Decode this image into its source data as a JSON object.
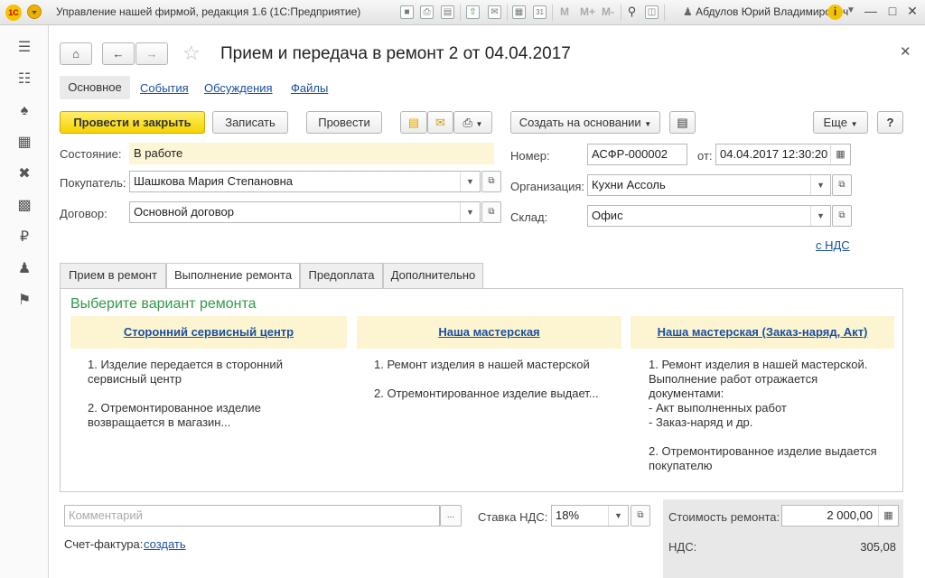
{
  "titlebar": {
    "logo": "1С",
    "title": "Управление нашей фирмой, редакция 1.6  (1С:Предприятие)",
    "user": "Абдулов Юрий Владимирович",
    "icons": [
      "save-icon",
      "print-icon",
      "preview-icon",
      "upload-icon",
      "mail-icon",
      "calculator-icon",
      "calendar-icon",
      "memory-icons",
      "search-icon",
      "window-icon"
    ],
    "m_labels": [
      "M",
      "M+",
      "M-"
    ],
    "calendar_day": "31"
  },
  "sidebar": {
    "items": [
      "menu-icon",
      "contacts-icon",
      "basket-icon",
      "production-icon",
      "tools-icon",
      "factory-icon",
      "money-icon",
      "people-icon",
      "flag-icon"
    ]
  },
  "doc": {
    "title": "Прием и передача в ремонт 2 от 04.04.2017",
    "tabs": [
      {
        "label": "Основное",
        "active": true
      },
      {
        "label": "События",
        "active": false
      },
      {
        "label": "Обсуждения",
        "active": false
      },
      {
        "label": "Файлы",
        "active": false
      }
    ]
  },
  "toolbar": {
    "post_close": "Провести и закрыть",
    "write": "Записать",
    "post": "Провести",
    "create_based": "Создать на основании",
    "more": "Еще",
    "help": "?"
  },
  "fields": {
    "state_label": "Состояние:",
    "state_value": "В работе",
    "buyer_label": "Покупатель:",
    "buyer_value": "Шашкова Мария Степановна",
    "contract_label": "Договор:",
    "contract_value": "Основной договор",
    "number_label": "Номер:",
    "number_value": "АСФР-000002",
    "date_label": "от:",
    "date_value": "04.04.2017 12:30:20",
    "org_label": "Организация:",
    "org_value": "Кухни Ассоль",
    "warehouse_label": "Склад:",
    "warehouse_value": "Офис",
    "vat_link": "с НДС"
  },
  "inner_tabs": [
    {
      "label": "Прием в ремонт",
      "active": false
    },
    {
      "label": "Выполнение ремонта",
      "active": true
    },
    {
      "label": "Предоплата",
      "active": false
    },
    {
      "label": "Дополнительно",
      "active": false
    }
  ],
  "panel": {
    "heading": "Выберите вариант ремонта",
    "variants": [
      {
        "title": "Сторонний сервисный центр",
        "text": "1. Изделие передается в сторонний\nсервисный центр\n\n2. Отремонтированное изделие\nвозвращается в магазин..."
      },
      {
        "title": "Наша мастерская",
        "text": "1. Ремонт изделия в нашей мастерской\n\n2. Отремонтированное изделие выдает..."
      },
      {
        "title": "Наша мастерская (Заказ-наряд, Акт)",
        "text": "1. Ремонт изделия в нашей мастерской.\nВыполнение работ отражается\nдокументами:\n- Акт выполненных работ\n- Заказ-наряд и др.\n\n2. Отремонтированное изделие выдается\nпокупателю"
      }
    ]
  },
  "bottom": {
    "comment_placeholder": "Комментарий",
    "comment_btn": "...",
    "vat_rate_label": "Ставка НДС:",
    "vat_rate_value": "18%",
    "invoice_label": "Счет-фактура:",
    "invoice_link": "создать",
    "repair_cost_label": "Стоимость ремонта:",
    "repair_cost_value": "2 000,00",
    "vat_label": "НДС:",
    "vat_value": "305,08"
  }
}
